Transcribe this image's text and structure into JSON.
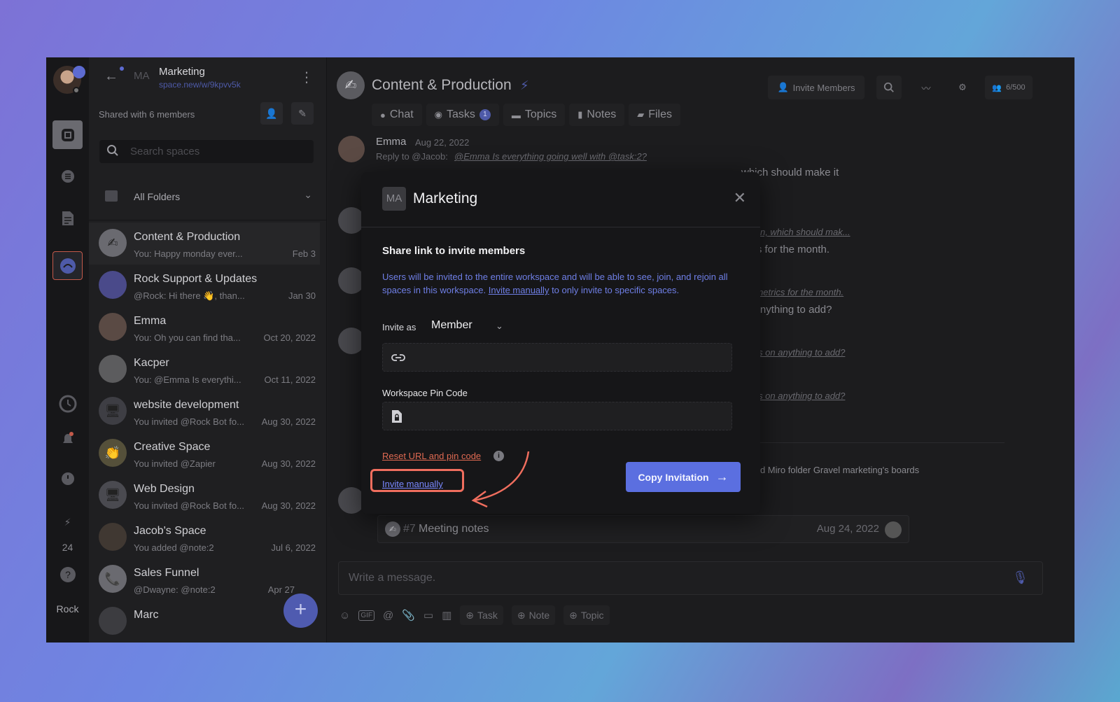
{
  "rail": {
    "badge_count": "24",
    "user_label": "Rock"
  },
  "sidebar": {
    "workspace_initials": "MA",
    "workspace_name": "Marketing",
    "workspace_url": "space.new/w/9kpvv5k",
    "shared_text": "Shared with 6 members",
    "search_placeholder": "Search spaces",
    "folders_label": "All Folders",
    "spaces": [
      {
        "name": "Content & Production",
        "preview": "You: Happy monday ever...",
        "date": "Feb 3"
      },
      {
        "name": "Rock Support & Updates",
        "preview": "@Rock: Hi there 👋, than...",
        "date": "Jan 30"
      },
      {
        "name": "Emma",
        "preview": "You: Oh you can find tha...",
        "date": "Oct 20, 2022"
      },
      {
        "name": "Kacper",
        "preview": "You: @Emma Is everythi...",
        "date": "Oct 11, 2022"
      },
      {
        "name": "website development",
        "preview": "You invited @Rock Bot fo...",
        "date": "Aug 30, 2022"
      },
      {
        "name": "Creative Space",
        "preview": "You invited @Zapier",
        "date": "Aug 30, 2022"
      },
      {
        "name": "Web Design",
        "preview": "You invited @Rock Bot fo...",
        "date": "Aug 30, 2022"
      },
      {
        "name": "Jacob's Space",
        "preview": "You added @note:2",
        "date": "Jul 6, 2022"
      },
      {
        "name": "Sales Funnel",
        "preview": "@Dwayne: @note:2",
        "date": "Apr 27"
      },
      {
        "name": "Marc",
        "preview": "",
        "date": ""
      }
    ]
  },
  "channel": {
    "title": "Content & Production",
    "tabs": [
      {
        "label": "Chat"
      },
      {
        "label": "Tasks",
        "count": "1"
      },
      {
        "label": "Topics"
      },
      {
        "label": "Notes"
      },
      {
        "label": "Files"
      }
    ],
    "invite_members": "Invite Members",
    "member_count": "6/500"
  },
  "messages": {
    "author": "Emma",
    "date": "Aug 22, 2022",
    "reply_prefix": "Reply to @Jacob:",
    "reply_link": "@Emma Is everything going well with @task:2?",
    "line1": "which should make it",
    "link2": "ation, which should mak...",
    "line2": "rics for the month.",
    "link3": "th metrics for the month.",
    "line3": "n anything to add?",
    "link4": "ghts on anything to add?",
    "link5": "ghts on anything to add?",
    "miro_text": "nked Miro folder Gravel marketing's boards",
    "note_number": "#7",
    "note_title": "Meeting notes",
    "note_date": "Aug 24, 2022"
  },
  "composer": {
    "placeholder": "Write a message.",
    "task_label": "Task",
    "note_label": "Note",
    "topic_label": "Topic"
  },
  "modal": {
    "initials": "MA",
    "title": "Marketing",
    "heading": "Share link to invite members",
    "desc_before": "Users will be invited to the entire workspace and will be able to see, join, and rejoin all spaces in this workspace. ",
    "desc_link": "Invite manually",
    "desc_after": " to only invite to specific spaces.",
    "invite_as_label": "Invite as",
    "role": "Member",
    "pin_label": "Workspace Pin Code",
    "reset_label": "Reset URL and pin code",
    "invite_manually": "Invite manually",
    "copy_button": "Copy Invitation"
  },
  "colors": {
    "accent": "#5b6fe0",
    "highlight": "#f06e5e",
    "link": "#7a88ff"
  }
}
